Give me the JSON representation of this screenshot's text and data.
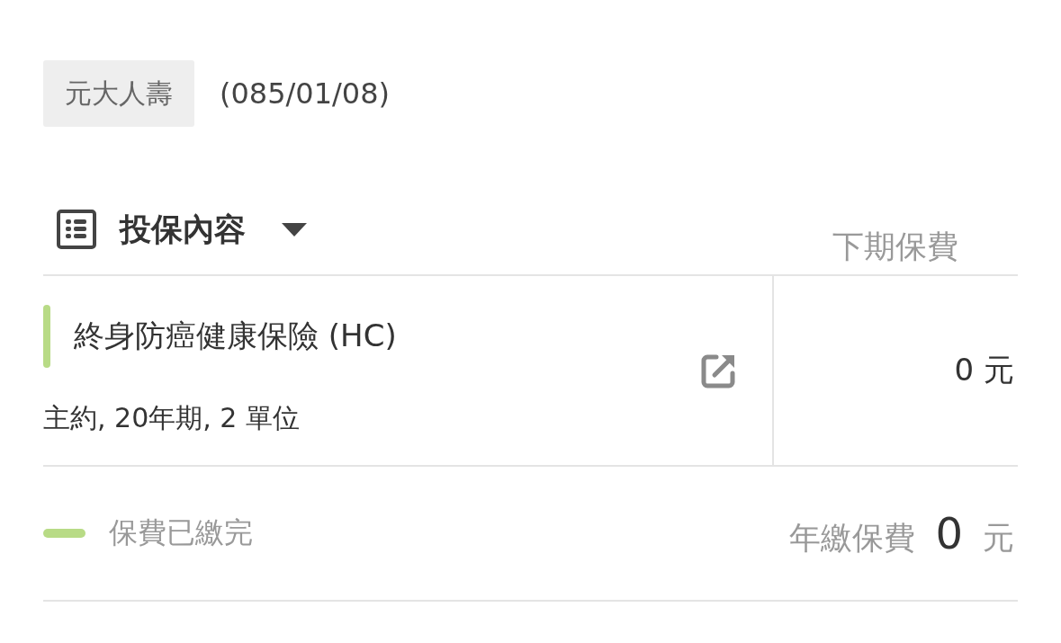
{
  "insurer": {
    "tag": "元大人壽",
    "date": "(085/01/08)"
  },
  "section": {
    "title": "投保內容",
    "next_premium_label": "下期保費"
  },
  "plans": [
    {
      "name": "終身防癌健康保險 (HC)",
      "detail": "主約, 20年期, 2 單位",
      "next_premium": "0 元"
    }
  ],
  "footer": {
    "status": "保費已繳完",
    "annual_label": "年繳保費",
    "annual_amount": "0",
    "annual_unit": "元"
  }
}
